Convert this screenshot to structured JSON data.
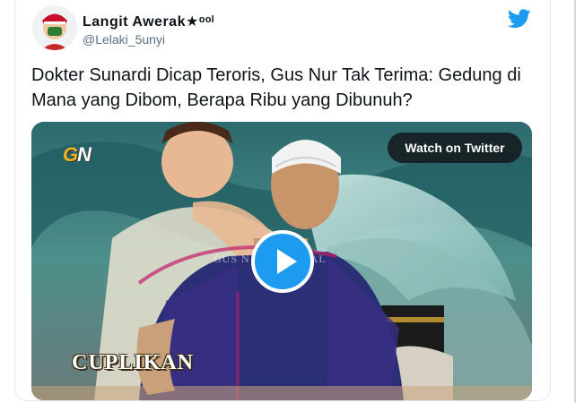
{
  "tweet": {
    "display_name": "Langit Awerak★ᵒᵒˡ",
    "handle": "@Lelaki_5unyi",
    "text": "Dokter Sunardi Dicap Teroris, Gus Nur Tak Terima: Gedung di Mana yang Dibom, Berapa Ribu yang Dibunuh?"
  },
  "video": {
    "watch_label": "Watch on Twitter",
    "channel_logo_prefix": "G",
    "channel_logo_suffix": "N",
    "watermark": "GUS N",
    "watermark_tail": "ICIAL",
    "caption": "CUPLIKAN"
  },
  "icons": {
    "brand": "twitter-bird-icon",
    "play": "play-icon"
  },
  "colors": {
    "twitter_blue": "#1d9bf0",
    "text_primary": "#0f1419",
    "text_secondary": "#5b7083"
  }
}
